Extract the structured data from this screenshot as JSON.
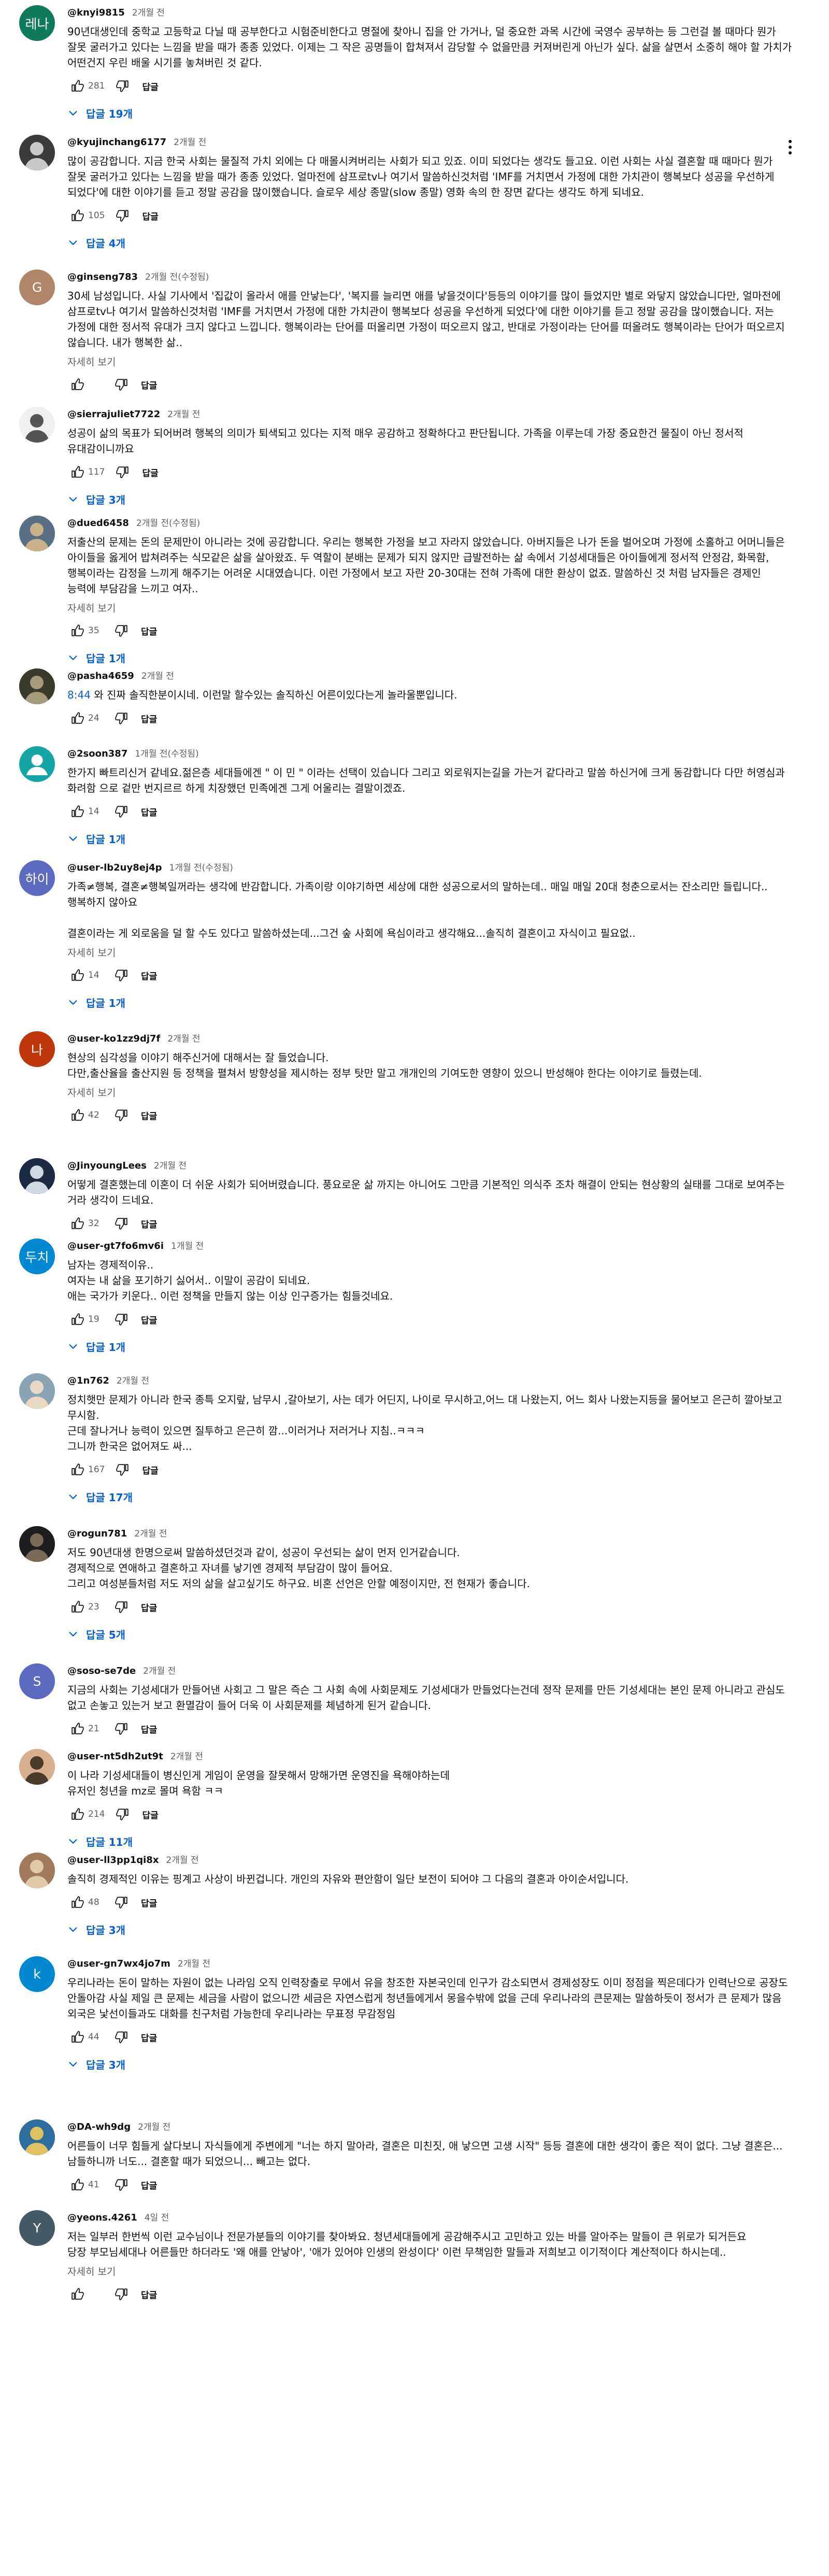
{
  "ui": {
    "reply_label": "답글",
    "more_label": "자세히 보기"
  },
  "comments": [
    {
      "handle": "@knyi9815",
      "time": "2개월 전",
      "text": "90년대생인데 중학교 고등학교 다닐 때 공부한다고 시험준비한다고 명절에 찾아니 집을 안 가거나, 덜 중요한 과목 시간에 국영수 공부하는 등 그런걸 볼 때마다 뭔가 잘못 굴러가고 있다는 느낌을 받을 때가 종종 있었다. 이제는 그 작은 공명들이 합쳐져서 감당할 수 없을만큼 커져버린게 아닌가 싶다. 삶을 살면서 소중히 해야 할 가치가 어떤건지 우린 배울 시기를 놓쳐버린 것 같다.",
      "likes": "281",
      "replies": "답글 19개",
      "avatar_text": "레나",
      "avatar_color": "#0f7a5c",
      "kebab": false,
      "more": false,
      "pic": false
    },
    {
      "handle": "@kyujinchang6177",
      "time": "2개월 전",
      "text": "많이 공감합니다. 지금 한국 사회는 물질적 가치 외에는 다 매몰시켜버리는 사회가 되고 있죠. 이미 되었다는 생각도 들고요. 이런 사회는 사실 결혼할 때 때마다 뭔가 잘못 굴러가고 있다는 느낌을 받을 때가 종종 있었다. 얼마전에 삼프로tv나 여기서 말씀하신것처럼 'IMF를 거치면서 가정에 대한 가치관이 행복보다 성공을 우선하게 되었다'에 대한 이야기를 듣고 정말 공감을 많이했습니다. 슬로우 세상 종말(slow 종말) 영화 속의 한 장면 같다는 생각도 하게 되네요.",
      "likes": "105",
      "replies": "답글 4개",
      "avatar_text": "",
      "avatar_color": "#8a8a8a",
      "kebab": true,
      "more": false,
      "pic": true,
      "pic_colors": [
        "#3b3b3b",
        "#c8c8c8"
      ]
    },
    {
      "handle": "@ginseng783",
      "time": "2개월 전(수정됨)",
      "text": "30세 남성입니다. 사실 기사에서 '집값이 올라서 애를 안낳는다', '복지를 늘리면 애를 낳을것이다'등등의 이야기를 많이 들었지만 별로 와닿지 않았습니다만, 얼마전에 삼프로tv나 여기서 말씀하신것처럼 'IMF를 거치면서 가정에 대한 가치관이 행복보다 성공을 우선하게 되었다'에 대한 이야기를 듣고 정말 공감을 많이했습니다. 저는 가정에 대한 정서적 유대가 크지 않다고 느낍니다. 행복이라는 단어를 떠올리면 가정이 떠오르지 않고, 반대로 가정이라는 단어를 떠올려도 행복이라는 단어가 떠오르지 않습니다. 내가 행복한 삶..",
      "likes": "",
      "replies": "",
      "avatar_text": "G",
      "avatar_color": "#b0866b",
      "kebab": false,
      "more": true,
      "pic": false
    },
    {
      "handle": "@sierrajuliet7722",
      "time": "2개월 전",
      "text": "성공이 삶의 목표가 되어버려 행복의 의미가 퇴색되고 있다는 지적 매우 공감하고 정확하다고 판단됩니다. 가족을 이루는데 가장 중요한건 물질이 아닌 정서적 유대감이니까요",
      "likes": "117",
      "replies": "답글 3개",
      "avatar_text": "",
      "avatar_color": "#d8d8d8",
      "kebab": false,
      "more": false,
      "pic": true,
      "pic_colors": [
        "#f0f0f0",
        "#555555"
      ]
    },
    {
      "handle": "@dued6458",
      "time": "2개월 전(수정됨)",
      "text": "저출산의 문제는 돈의 문제만이 아니라는 것에 공감합니다. 우리는 행복한 가정을 보고 자라지 않았습니다. 아버지들은 나가 돈을 벌어오며 가정에 소홀하고 어머니들은 아이들을 옳게어 밥쳐려주는 식모같은 삶을 살아왔죠. 두 역할이 분배는 문제가 되지 않지만 급발전하는 삶 속에서 기성세대들은 아이들에게 정서적 안정감, 화목함, 행복이라는 감정을 느끼게 해주기는 어려운 시대였습니다. 이런 가정에서 보고 자란 20-30대는 전혀 가족에 대한 환상이 없죠. 말씀하신 것 처럼 남자들은 경제인 능력에 부담감을 느끼고 여자..",
      "likes": "35",
      "replies": "답글 1개",
      "avatar_text": "",
      "avatar_color": "#6a7a8a",
      "kebab": false,
      "more": true,
      "pic": true,
      "pic_colors": [
        "#5b6f84",
        "#c9b28b"
      ]
    },
    {
      "handle": "@pasha4659",
      "time": "2개월 전",
      "ts": "8:44",
      "text": " 와 진짜 솔직한분이시네. 이런말 할수있는 솔직하신 어른이있다는게 놀라울뿐입니다.",
      "likes": "24",
      "replies": "",
      "avatar_text": "",
      "avatar_color": "#4a4a3a",
      "kebab": false,
      "more": false,
      "pic": true,
      "pic_colors": [
        "#3a3a2a",
        "#a59a7a"
      ]
    },
    {
      "handle": "@2soon387",
      "time": "1개월 전(수정됨)",
      "text": "한가지 빠트리신거 같네요.젊은층 세대들에겐 \" 이 민 \" 이라는 선택이 있습니다 그리고 외로워지는길을 가는거 같다라고 말씀 하신거에 크게 동감합니다 다만 허영심과 화려함 으로 겉만 번지르르 하게 치장했던 민족에겐 그게 어울리는 결말이겠죠.",
      "likes": "14",
      "replies": "답글 1개",
      "avatar_text": "",
      "avatar_color": "#16a5a5",
      "kebab": false,
      "more": false,
      "pic": false,
      "person": true
    },
    {
      "handle": "@user-lb2uy8ej4p",
      "time": "1개월 전(수정됨)",
      "text": "가족≠행복, 결혼≠행복일꺼라는 생각에 반감합니다. 가족이랑 이야기하면 세상에 대한 성공으로서의 말하는데.. 매일 매일 20대 청춘으로서는 잔소리만 들립니다..행복하지 않아요\n\n결혼이라는 게 외로움을 덜 할 수도 있다고 말씀하셨는데...그건 숲 사회에 욕심이라고 생각해요...솔직히 결혼이고 자식이고 필요없..",
      "likes": "14",
      "replies": "답글 1개",
      "avatar_text": "하이",
      "avatar_color": "#5c6bc0",
      "kebab": false,
      "more": true,
      "pic": false
    },
    {
      "handle": "@user-ko1zz9dj7f",
      "time": "2개월 전",
      "text": "현상의 심각성을 이야기 해주신거에 대해서는 잘 들었습니다.\n 다만,출산율을 출산지원 등 정책을 펼쳐서 방향성을 제시하는 정부 탓만 말고 개개인의 기여도한 영향이 있으니 반성해야 한다는 이야기로 들렸는데.\n",
      "likes": "42",
      "replies": "",
      "avatar_text": "나",
      "avatar_color": "#bf360c",
      "kebab": false,
      "more": true,
      "pic": false
    },
    {
      "handle": "@JinyoungLees",
      "time": "2개월 전",
      "text": "어떻게 결혼했는데 이혼이 더 쉬운 사회가 되어버렸습니다. 풍요로운 삶 까지는 아니어도 그만큼 기본적인 의식주 조차 해결이 안되는 현상황의 실태를 그대로 보여주는 거라 생각이 드네요.",
      "likes": "32",
      "replies": "",
      "avatar_text": "",
      "avatar_color": "#26324a",
      "kebab": false,
      "more": false,
      "pic": true,
      "pic_colors": [
        "#1c2a44",
        "#cfd8e3"
      ]
    },
    {
      "handle": "@user-gt7fo6mv6i",
      "time": "1개월 전",
      "text": "남자는 경제적이유..\n여자는 내 삶을 포기하기 싫어서..  이말이 공감이 되네요.\n애는 국가가 키운다.. 이런 정책을 만들지 않는 이상 인구증가는 힘들것네요.",
      "likes": "19",
      "replies": "답글 1개",
      "avatar_text": "두치",
      "avatar_color": "#0288d1",
      "kebab": false,
      "more": false,
      "pic": false
    },
    {
      "handle": "@1n762",
      "time": "2개월 전",
      "text": "정치햇만 문제가 아니라 한국 종특 오지랖, 남무시 ,갈아보기, 사는 데가 어딘지, 나이로 무시하고,어느 대 나왔는지,  어느 회사 나왔는지등을 물어보고 은근히 깔아보고 무시함.\n근데 잘나거나 능력이 있으면 질투하고 은근히 깜...이러거나 저러거나 지침..ㅋㅋㅋ\n그니까 한국은 없어져도 싸...",
      "likes": "167",
      "replies": "답글 17개",
      "avatar_text": "",
      "avatar_color": "#9fb8c8",
      "kebab": false,
      "more": false,
      "pic": true,
      "pic_colors": [
        "#8aa4b4",
        "#e8d8c4"
      ]
    },
    {
      "handle": "@rogun781",
      "time": "2개월 전",
      "text": "저도 90년대생 한명으로써 말씀하셨던것과 같이, 성공이 우선되는 삶이 먼저 인거같습니다.\n경제적으로 연애하고 결혼하고 자녀를 낳기엔 경제적 부담감이 많이 들어요.\n그리고 여성분들처럼 저도 저의 삶을 살고싶기도 하구요. 비혼 선언은 안할 예정이지만, 전 현재가 좋습니다.",
      "likes": "23",
      "replies": "답글 5개",
      "avatar_text": "",
      "avatar_color": "#2e2e2e",
      "kebab": false,
      "more": false,
      "pic": true,
      "pic_colors": [
        "#1e1e1e",
        "#7a6a5a"
      ]
    },
    {
      "handle": "@soso-se7de",
      "time": "2개월 전",
      "text": "지금의 사회는 기성세대가 만들어낸 사회고 그 말은 즉슨 그 사회 속에 사회문제도 기성세대가 만들었다는건데 정작 문제를 만든 기성세대는 본인 문제 아니라고 관심도 없고 손놓고 있는거 보고 환멸감이 들어 더욱 이 사회문제를 체념하게 된거 같습니다.",
      "likes": "21",
      "replies": "",
      "avatar_text": "S",
      "avatar_color": "#5c6bc0",
      "kebab": false,
      "more": false,
      "pic": false
    },
    {
      "handle": "@user-nt5dh2ut9t",
      "time": "2개월 전",
      "text": "이 나라 기성세대들이 병신인게 게임이 운영을 잘못해서 망해가면 운영진을 욕해야하는데\n유저인 청년을 mz로 몰며 욕함 ㅋㅋ",
      "likes": "214",
      "replies": "답글 11개",
      "avatar_text": "",
      "avatar_color": "#c89a7a",
      "kebab": false,
      "more": false,
      "pic": true,
      "pic_colors": [
        "#d8b090",
        "#4a3a2a"
      ]
    },
    {
      "handle": "@user-ll3pp1qi8x",
      "time": "2개월 전",
      "text": "솔직히 경제적인 이유는 핑계고 사상이 바뀐겁니다. 개인의 자유와 편안함이 일단 보전이 되어야 그 다음의 결혼과 아이순서입니다.",
      "likes": "48",
      "replies": "답글 3개",
      "avatar_text": "",
      "avatar_color": "#b08a6a",
      "kebab": false,
      "more": false,
      "pic": true,
      "pic_colors": [
        "#a07a5a",
        "#e0c8a8"
      ]
    },
    {
      "handle": "@user-gn7wx4jo7m",
      "time": "2개월 전",
      "text": "우리나라는 돈이 말하는 자원이 없는 나라임 오직 인력장출로 무에서 유을 창조한 자본국인데 인구가 감소되면서 경제성장도 이미 정점을 찍은데다가 인력난으로 공장도 안돌아감 사실 제일 큰 문제는 세금을 사람이 없으니깐 세금은 자연스럽게 청년들에게서 몽을수밖에 없을 근데 우리나라의 큰문제는 말씀하듯이 정서가 큰 문제가 많음 외국은 낯선이들과도 대화를 친구처럼 가능한데 우리나라는 무표정 무감정임",
      "likes": "44",
      "replies": "답글 3개",
      "avatar_text": "k",
      "avatar_color": "#0288d1",
      "kebab": false,
      "more": false,
      "pic": false
    },
    {
      "handle": "@DA-wh9dg",
      "time": "2개월 전",
      "text": "어른들이 너무 힘들게 살다보니 자식들에게 주변에게 \"너는 하지 말아라, 결혼은 미친짓, 애 낳으면 고생 시작\" 등등 결혼에 대한 생각이 좋은 적이 없다. 그냥 결혼은... 남들하니까 너도... 결혼할 때가 되었으니... 빼고는 없다.",
      "likes": "41",
      "replies": "",
      "avatar_text": "",
      "avatar_color": "#3a7a3a",
      "kebab": false,
      "more": false,
      "pic": true,
      "pic_colors": [
        "#2e6e9e",
        "#e0c060"
      ]
    },
    {
      "handle": "@yeons.4261",
      "time": "4일 전",
      "text": "저는 일부러 한번씩 이런 교수님이나 전문가분들의 이야기를 찾아봐요. 청년세대들에게 공감해주시고 고민하고 있는 바를 알아주는 말들이 큰 위로가 되거든요\n당장 부모님세대나 어른들만 하더라도 '왜 애를 안낳아', '애가 있어야 인생의 완성이다' 이런 무책임한 말들과 저희보고 이기적이다 계산적이다 하시는데..",
      "likes": "",
      "replies": "",
      "avatar_text": "Y",
      "avatar_color": "#455a64",
      "kebab": false,
      "more": true,
      "pic": false
    }
  ]
}
